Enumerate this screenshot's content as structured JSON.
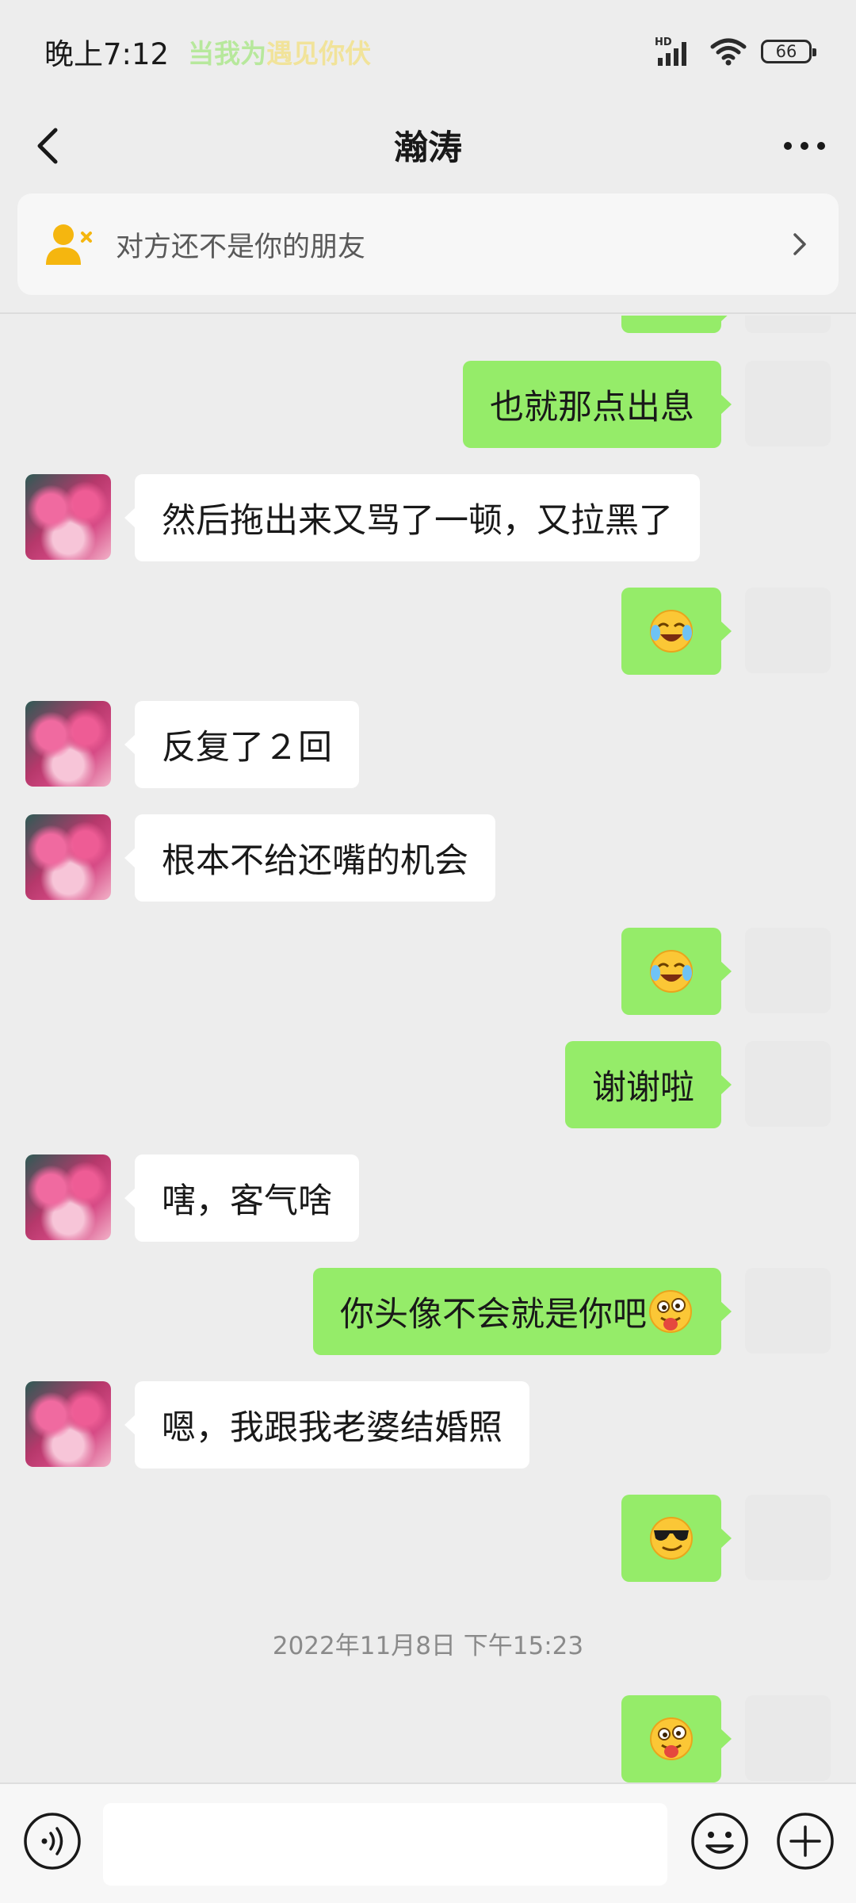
{
  "status_bar": {
    "time": "晚上7:12",
    "ticker_a": "当我为",
    "ticker_b": "遇见你伏",
    "network": "HD",
    "battery": "66"
  },
  "nav": {
    "title": "瀚涛"
  },
  "banner": {
    "text": "对方还不是你的朋友"
  },
  "messages": {
    "m1": "也就那点出息",
    "m2": "然后拖出来又骂了一顿，又拉黑了",
    "m4": "反复了２回",
    "m5": "根本不给还嘴的机会",
    "m7": "谢谢啦",
    "m8": "嗐，客气啥",
    "m9": "你头像不会就是你吧",
    "m10": "嗯，我跟我老婆结婚照"
  },
  "timestamp": "2022年11月8日 下午15:23",
  "emoji_names": [
    "laughing-crying-emoji",
    "sunglasses-emoji",
    "tongue-out-emoji"
  ],
  "colors": {
    "outgoing_bubble": "#95ec69",
    "incoming_bubble": "#ffffff",
    "background": "#ededed"
  }
}
